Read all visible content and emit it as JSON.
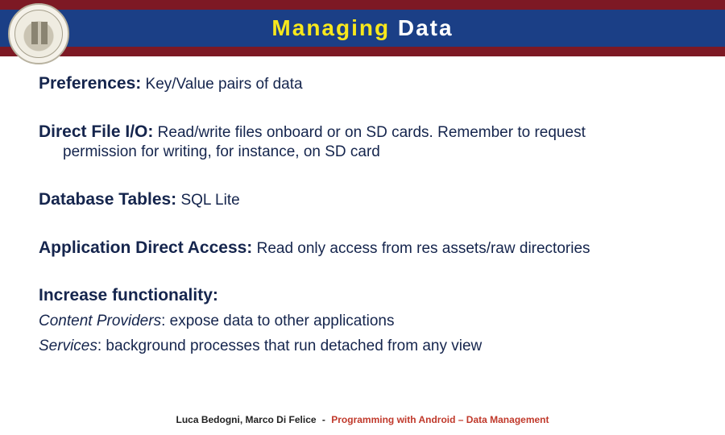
{
  "title": {
    "highlight": "Managing",
    "rest": " Data"
  },
  "items": {
    "preferences": {
      "label": "Preferences:",
      "body": " Key/Value pairs of data"
    },
    "fileio": {
      "label": "Direct File I/O:",
      "body": " Read/write files onboard or on SD cards. Remember to request",
      "cont": "permission for writing, for instance, on SD card"
    },
    "database": {
      "label": "Database Tables:",
      "body": " SQL Lite"
    },
    "appdirect": {
      "label": "Application Direct Access:",
      "body": " Read only access from res assets/raw directories"
    },
    "increase": {
      "label": "Increase functionality:",
      "sub1": {
        "em": "Content Providers",
        "text": ": expose data to other applications"
      },
      "sub2": {
        "em": "Services",
        "text": ": background processes that run detached from any view"
      }
    }
  },
  "footer": {
    "authors": "Luca Bedogni, Marco Di Felice",
    "sep": "-",
    "course": "Programming with Android – Data Management"
  }
}
